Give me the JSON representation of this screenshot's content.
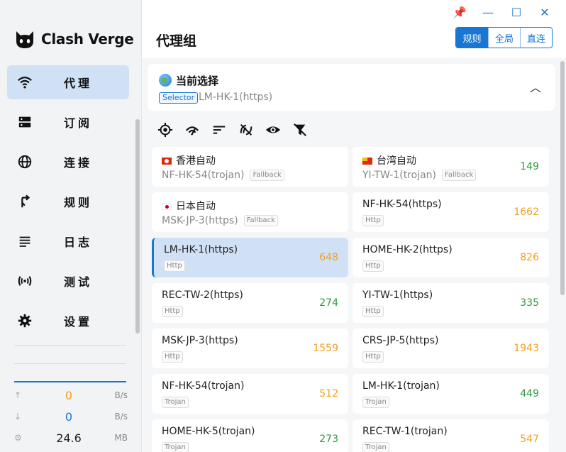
{
  "brand": {
    "name": "Clash Verge"
  },
  "nav": [
    {
      "id": "proxy",
      "label": "代理",
      "icon": "wifi-icon",
      "active": true
    },
    {
      "id": "profiles",
      "label": "订阅",
      "icon": "dns-icon",
      "active": false
    },
    {
      "id": "connections",
      "label": "连接",
      "icon": "globe-icon",
      "active": false
    },
    {
      "id": "rules",
      "label": "规则",
      "icon": "fork-icon",
      "active": false
    },
    {
      "id": "logs",
      "label": "日志",
      "icon": "list-icon",
      "active": false
    },
    {
      "id": "test",
      "label": "测试",
      "icon": "signal-icon",
      "active": false
    },
    {
      "id": "settings",
      "label": "设置",
      "icon": "gear-icon",
      "active": false
    }
  ],
  "traffic": {
    "up": {
      "icon": "arrow-up-icon",
      "value": "0",
      "unit": "B/s"
    },
    "down": {
      "icon": "arrow-down-icon",
      "value": "0",
      "unit": "B/s"
    },
    "memory": {
      "icon": "memory-icon",
      "value": "24.6",
      "unit": "MB"
    }
  },
  "window": {
    "pin": "pin-icon",
    "minimize": "minimize-icon",
    "maximize": "maximize-icon",
    "close": "close-icon"
  },
  "header": {
    "title": "代理组",
    "modes": [
      {
        "label": "规则",
        "active": true
      },
      {
        "label": "全局",
        "active": false
      },
      {
        "label": "直连",
        "active": false
      }
    ]
  },
  "group": {
    "name": "当前选择",
    "type": "Selector",
    "now": "LM-HK-1(https)"
  },
  "toolbar": [
    "locate-icon",
    "speed-test-icon",
    "sort-icon",
    "delay-filter-icon",
    "eye-icon",
    "filter-off-icon"
  ],
  "nodes": [
    {
      "name": "香港自动",
      "flag": "hk",
      "now": "NF-HK-54(trojan)",
      "tag": "Fallback",
      "delay": "",
      "color": ""
    },
    {
      "name": "台湾自动",
      "flag": "tw",
      "now": "YI-TW-1(trojan)",
      "tag": "Fallback",
      "delay": "149",
      "color": "green"
    },
    {
      "name": "日本自动",
      "flag": "jp",
      "now": "MSK-JP-3(https)",
      "tag": "Fallback",
      "delay": "",
      "color": ""
    },
    {
      "name": "NF-HK-54(https)",
      "flag": "",
      "now": "",
      "tag": "Http",
      "delay": "1662",
      "color": "orange"
    },
    {
      "name": "LM-HK-1(https)",
      "flag": "",
      "now": "",
      "tag": "Http",
      "delay": "648",
      "color": "orange",
      "selected": true
    },
    {
      "name": "HOME-HK-2(https)",
      "flag": "",
      "now": "",
      "tag": "Http",
      "delay": "826",
      "color": "orange"
    },
    {
      "name": "REC-TW-2(https)",
      "flag": "",
      "now": "",
      "tag": "Http",
      "delay": "274",
      "color": "green"
    },
    {
      "name": "YI-TW-1(https)",
      "flag": "",
      "now": "",
      "tag": "Http",
      "delay": "335",
      "color": "green"
    },
    {
      "name": "MSK-JP-3(https)",
      "flag": "",
      "now": "",
      "tag": "Http",
      "delay": "1559",
      "color": "orange"
    },
    {
      "name": "CRS-JP-5(https)",
      "flag": "",
      "now": "",
      "tag": "Http",
      "delay": "1943",
      "color": "orange"
    },
    {
      "name": "NF-HK-54(trojan)",
      "flag": "",
      "now": "",
      "tag": "Trojan",
      "delay": "512",
      "color": "orange"
    },
    {
      "name": "LM-HK-1(trojan)",
      "flag": "",
      "now": "",
      "tag": "Trojan",
      "delay": "449",
      "color": "green"
    },
    {
      "name": "HOME-HK-5(trojan)",
      "flag": "",
      "now": "",
      "tag": "Trojan",
      "delay": "273",
      "color": "green"
    },
    {
      "name": "REC-TW-1(trojan)",
      "flag": "",
      "now": "",
      "tag": "Trojan",
      "delay": "547",
      "color": "orange"
    }
  ]
}
